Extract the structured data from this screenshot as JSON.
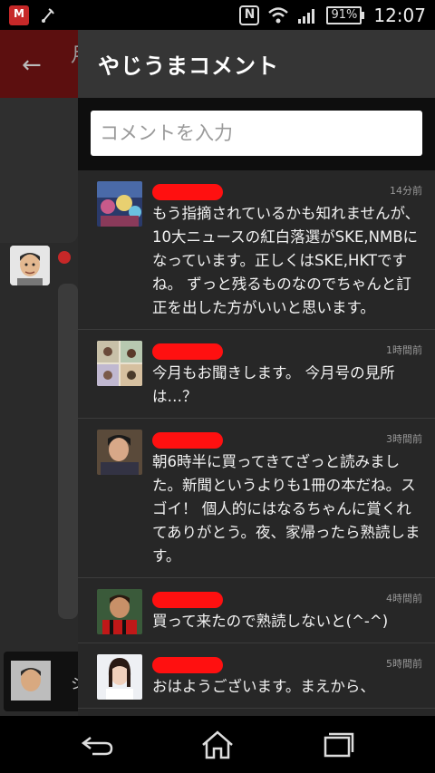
{
  "status_bar": {
    "clock": "12:07",
    "battery": "91%",
    "icons": [
      "mcafee-icon",
      "usb-debug-icon",
      "nfc-icon",
      "wifi-icon",
      "signal-icon",
      "battery-icon"
    ]
  },
  "background_app": {
    "title_fragment": "月",
    "bottom_fragment": "シ"
  },
  "drawer": {
    "title": "やじうまコメント",
    "input_placeholder": "コメントを入力"
  },
  "comments": [
    {
      "time": "14分前",
      "text": "もう指摘されているかも知れませんが、10大ニュースの紅白落選がSKE,NMBになっています。正しくはSKE,HKTですね。 ずっと残るものなのでちゃんと訂正を出した方がいいと思います。",
      "avatar": "collage-photo-avatar"
    },
    {
      "time": "1時間前",
      "text": "今月もお聞きします。 今月号の見所は…？",
      "avatar": "group-photo-avatar"
    },
    {
      "time": "3時間前",
      "text": "朝6時半に買ってきてざっと読みました。新聞というよりも1冊の本だね。スゴイ！ 個人的にはなるちゃんに賞くれてありがとう。夜、家帰ったら熟読します。",
      "avatar": "person-photo-avatar"
    },
    {
      "time": "4時間前",
      "text": "買って来たので熟読しないと(^-^)",
      "avatar": "soccer-player-avatar"
    },
    {
      "time": "5時間前",
      "text": "おはようございます。まえから、",
      "avatar": "girl-photo-avatar"
    }
  ],
  "nav_bar": {
    "buttons": [
      "back-icon",
      "home-icon",
      "recent-apps-icon"
    ]
  },
  "colors": {
    "drawer_bg": "#272727",
    "header_bg": "#353535",
    "redaction": "#ff1010",
    "app_header": "#5c0f0f"
  }
}
